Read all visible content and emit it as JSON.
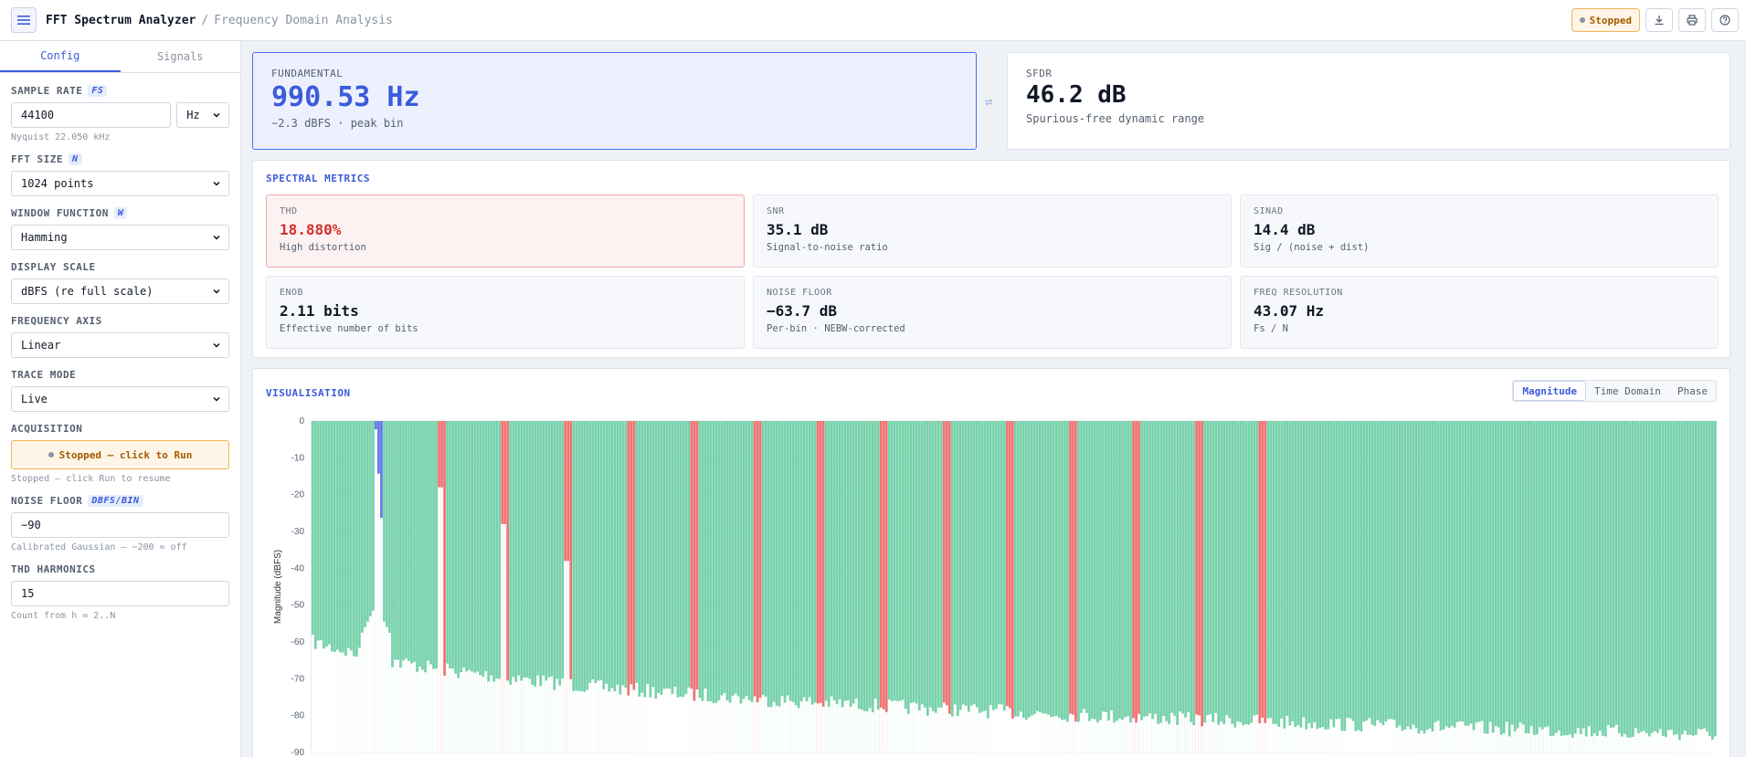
{
  "header": {
    "title": "FFT Spectrum Analyzer",
    "separator": "/",
    "subtitle": "Frequency Domain Analysis",
    "status": "Stopped"
  },
  "sidebar": {
    "tabs": [
      "Config",
      "Signals"
    ],
    "sample_rate": {
      "label": "SAMPLE RATE",
      "tag": "FS",
      "value": "44100",
      "unit": "Hz",
      "hint": "Nyquist 22.050 kHz"
    },
    "fft_size": {
      "label": "FFT SIZE",
      "tag": "N",
      "value": "1024 points"
    },
    "window_function": {
      "label": "WINDOW FUNCTION",
      "tag": "W",
      "value": "Hamming"
    },
    "display_scale": {
      "label": "DISPLAY SCALE",
      "value": "dBFS (re full scale)"
    },
    "frequency_axis": {
      "label": "FREQUENCY AXIS",
      "value": "Linear"
    },
    "trace_mode": {
      "label": "TRACE MODE",
      "value": "Live"
    },
    "acquisition": {
      "label": "ACQUISITION",
      "button": "Stopped — click to Run",
      "hint": "Stopped — click Run to resume"
    },
    "noise_floor": {
      "label": "NOISE FLOOR",
      "tag": "DBFS/BIN",
      "value": "−90",
      "hint": "Calibrated Gaussian — −200 = off"
    },
    "thd_harmonics": {
      "label": "THD HARMONICS",
      "value": "15",
      "hint": "Count from h = 2..N"
    }
  },
  "fundamental": {
    "label": "FUNDAMENTAL",
    "value": "990.53 Hz",
    "sub": "−2.3 dBFS · peak bin"
  },
  "sfdr": {
    "label": "SFDR",
    "value": "46.2 dB",
    "sub": "Spurious-free dynamic range"
  },
  "metrics": {
    "title": "SPECTRAL METRICS",
    "items": [
      {
        "label": "THD",
        "value": "18.880%",
        "sub": "High distortion"
      },
      {
        "label": "SNR",
        "value": "35.1 dB",
        "sub": "Signal-to-noise ratio"
      },
      {
        "label": "SINAD",
        "value": "14.4 dB",
        "sub": "Sig / (noise + dist)"
      },
      {
        "label": "ENOB",
        "value": "2.11 bits",
        "sub": "Effective number of bits"
      },
      {
        "label": "NOISE FLOOR",
        "value": "−63.7 dB",
        "sub": "Per-bin · NEBW-corrected"
      },
      {
        "label": "FREQ RESOLUTION",
        "value": "43.07 Hz",
        "sub": "Fs / N"
      }
    ]
  },
  "visualisation": {
    "title": "VISUALISATION",
    "tabs": [
      "Magnitude",
      "Time Domain",
      "Phase"
    ]
  },
  "colors": {
    "accent": "#3b5bdb",
    "noise": "#6fcfa5",
    "harmonic": "#ef6a6a",
    "fundamental": "#5470e6"
  },
  "chart_data": {
    "type": "bar",
    "ylabel": "Magnitude (dBFS)",
    "ylim": [
      -90,
      0
    ],
    "yticks": [
      0,
      -10,
      -20,
      -30,
      -40,
      -50,
      -60,
      -70,
      -80,
      -90
    ],
    "grid": true,
    "fundamental_bin": 23,
    "harmonic_bins": [
      46,
      69,
      92,
      115,
      138,
      161,
      184,
      207,
      230,
      253,
      276,
      299,
      322,
      345
    ],
    "bins_shown": 512,
    "fundamental_dbfs": -2.3,
    "noise_floor_dbfs": -63.7
  }
}
